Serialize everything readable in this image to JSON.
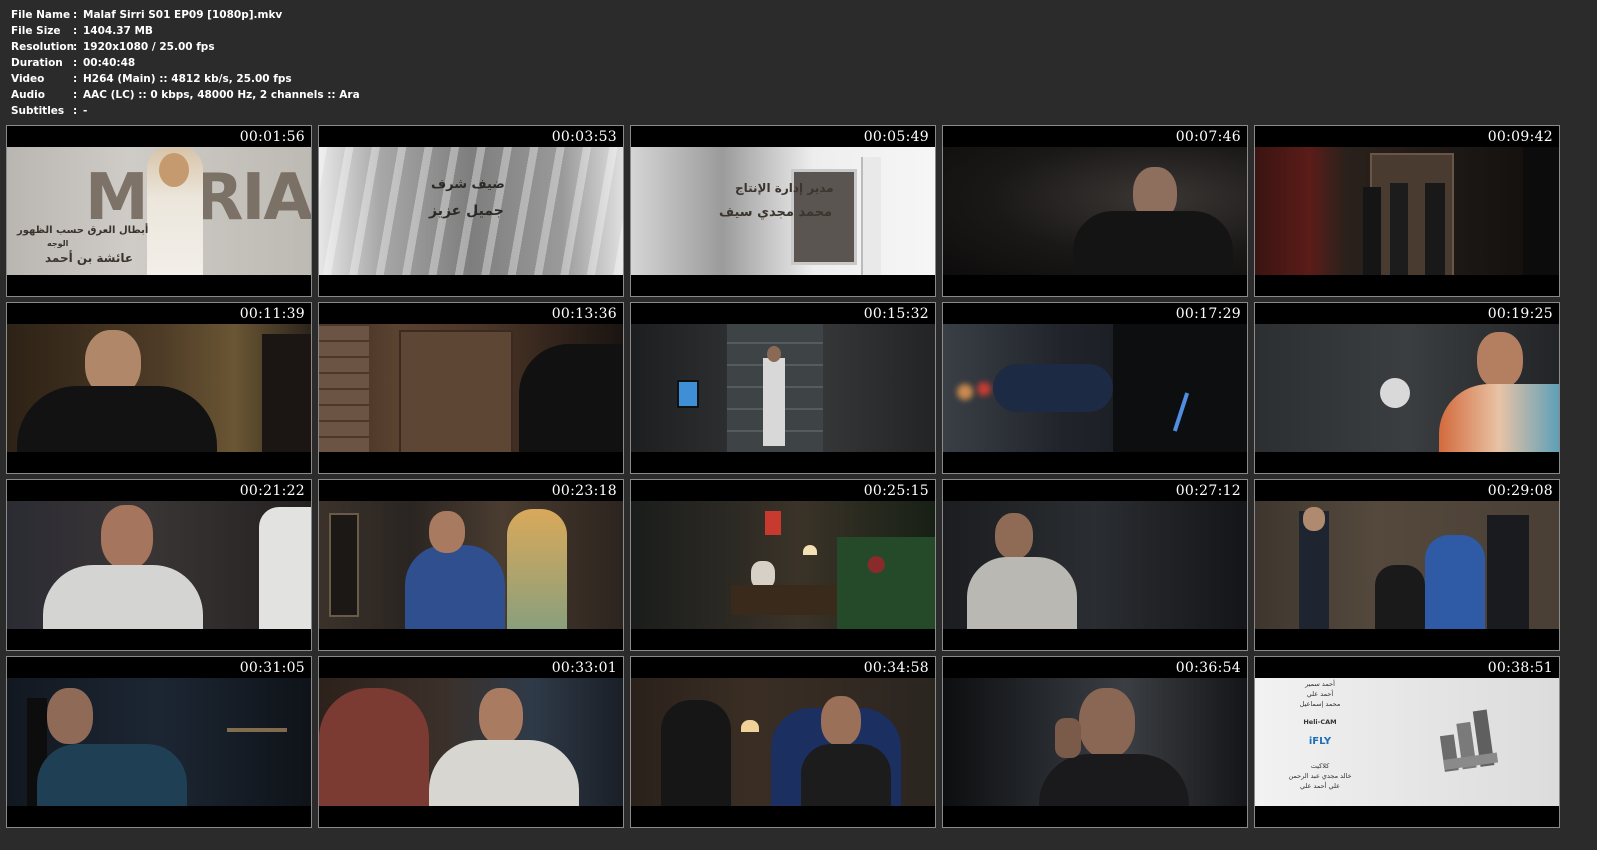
{
  "info": [
    {
      "label": "File Name",
      "value": "Malaf Sirri S01 EP09 [1080p].mkv"
    },
    {
      "label": "File Size",
      "value": "1404.37 MB"
    },
    {
      "label": "Resolution",
      "value": "1920x1080 / 25.00 fps"
    },
    {
      "label": "Duration",
      "value": "00:40:48"
    },
    {
      "label": "Video",
      "value": "H264 (Main) :: 4812 kb/s, 25.00 fps"
    },
    {
      "label": "Audio",
      "value": "AAC (LC) :: 0 kbps, 48000 Hz, 2 channels :: Ara"
    },
    {
      "label": "Subtitles",
      "value": "-"
    }
  ],
  "separator": ":",
  "thumbnails": [
    {
      "time": "00:01:56"
    },
    {
      "time": "00:03:53"
    },
    {
      "time": "00:05:49"
    },
    {
      "time": "00:07:46"
    },
    {
      "time": "00:09:42"
    },
    {
      "time": "00:11:39"
    },
    {
      "time": "00:13:36"
    },
    {
      "time": "00:15:32"
    },
    {
      "time": "00:17:29"
    },
    {
      "time": "00:19:25"
    },
    {
      "time": "00:21:22"
    },
    {
      "time": "00:23:18"
    },
    {
      "time": "00:25:15"
    },
    {
      "time": "00:27:12"
    },
    {
      "time": "00:29:08"
    },
    {
      "time": "00:31:05"
    },
    {
      "time": "00:33:01"
    },
    {
      "time": "00:34:58"
    },
    {
      "time": "00:36:54"
    },
    {
      "time": "00:38:51"
    }
  ],
  "frame_text": {
    "t1_line1": "MARIAM",
    "t1_line2": "أبطال العرق حسب الظهور",
    "t1_line3": "الوجه",
    "t1_line4": "عائشة بن أحمد",
    "t2_line1": "ضيف شرف",
    "t2_line2": "جميل عزيز",
    "t3_line1": "مدير إدارة الإنتاج",
    "t3_line2": "محمد مجدي سيف",
    "t20_line1": "أحمد سمير",
    "t20_line2": "أحمد علي",
    "t20_line3": "محمد إسماعيل",
    "t20_line4": "Heli-CAM",
    "t20_line5": "iFLY",
    "t20_line6": "كلاكيت",
    "t20_line7": "خالد مجدي عبد الرحمن",
    "t20_line8": "علي أحمد علي"
  },
  "colors": {
    "background": "#2b2b2b",
    "thumb_border": "#8a8a8a",
    "text": "#ffffff"
  }
}
